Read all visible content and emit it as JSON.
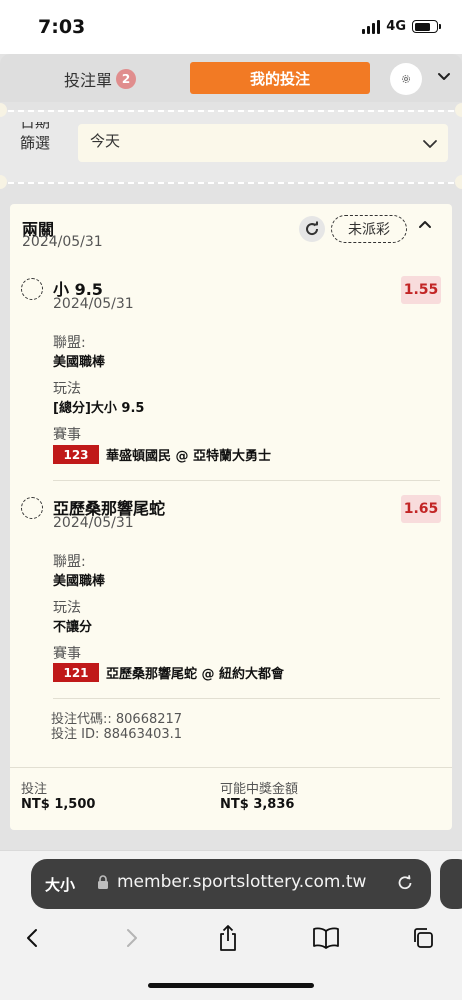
{
  "status_bar": {
    "time": "7:03",
    "network": "4G"
  },
  "tabs": {
    "bet_slip_label": "投注單",
    "bet_slip_count": "2",
    "my_bets_label": "我的投注"
  },
  "filter": {
    "label_cut": "日期",
    "label": "篩選",
    "value": "今天"
  },
  "bet": {
    "type": "兩關",
    "date": "2024/05/31",
    "status": "未派彩",
    "selections": [
      {
        "name": "小 9.5",
        "date": "2024/05/31",
        "odds": "1.55",
        "league_label": "聯盟:",
        "league": "美國職棒",
        "market_label": "玩法",
        "market": "[總分]大小 9.5",
        "event_label": "賽事",
        "event_no": "123",
        "event": "華盛頓國民 @ 亞特蘭大勇士"
      },
      {
        "name": "亞歷桑那響尾蛇",
        "date": "2024/05/31",
        "odds": "1.65",
        "league_label": "聯盟:",
        "league": "美國職棒",
        "market_label": "玩法",
        "market": "不讓分",
        "event_label": "賽事",
        "event_no": "121",
        "event": "亞歷桑那響尾蛇 @ 紐約大都會"
      }
    ],
    "code_line": "投注代碼:: 80668217",
    "id_line": "投注 ID: 88463403.1",
    "stake_label": "投注",
    "stake_value": "NT$ 1,500",
    "payout_label": "可能中獎金額",
    "payout_value": "NT$ 3,836"
  },
  "browser": {
    "text_size": "大小",
    "url": "member.sportslottery.com.tw"
  },
  "colors": {
    "accent": "#f27a24",
    "odds_text": "#c22525",
    "event_badge": "#c01919"
  }
}
